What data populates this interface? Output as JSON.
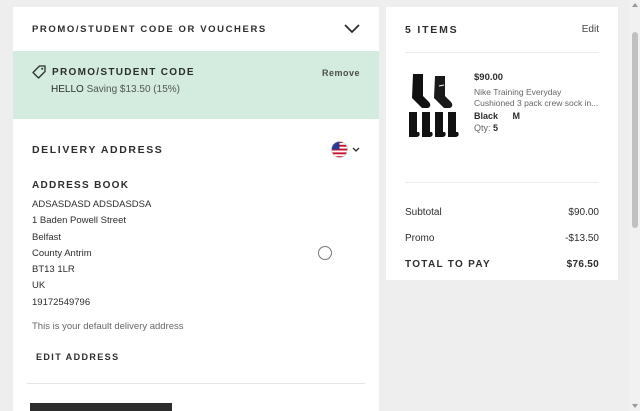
{
  "promo_section": {
    "header": "PROMO/STUDENT CODE OR VOUCHERS",
    "applied_title": "PROMO/STUDENT CODE",
    "remove_label": "Remove",
    "code": "HELLO",
    "saving_text": "Saving $13.50 (15%)",
    "applied_bg": "#d3ecdf"
  },
  "delivery": {
    "title": "DELIVERY ADDRESS",
    "country_flag": "us-flag-icon",
    "address_book_title": "ADDRESS BOOK",
    "address_lines": [
      "ADSASDASD ADSDASDSA",
      "1 Baden Powell Street",
      "Belfast",
      "County Antrim",
      "BT13 1LR",
      "UK",
      "19172549796"
    ],
    "default_note": "This is your default delivery address",
    "edit_label": "EDIT ADDRESS"
  },
  "bag": {
    "title": "5 ITEMS",
    "edit_label": "Edit",
    "item": {
      "price": "$90.00",
      "name_line1": "Nike Training Everyday",
      "name_line2": "Cushioned 3 pack crew sock in...",
      "color": "Black",
      "size": "M",
      "qty_label": "Qty:",
      "qty": "5"
    },
    "subtotal_label": "Subtotal",
    "subtotal": "$90.00",
    "promo_label": "Promo",
    "promo_value": "-$13.50",
    "total_label": "TOTAL TO PAY",
    "total": "$76.50"
  }
}
